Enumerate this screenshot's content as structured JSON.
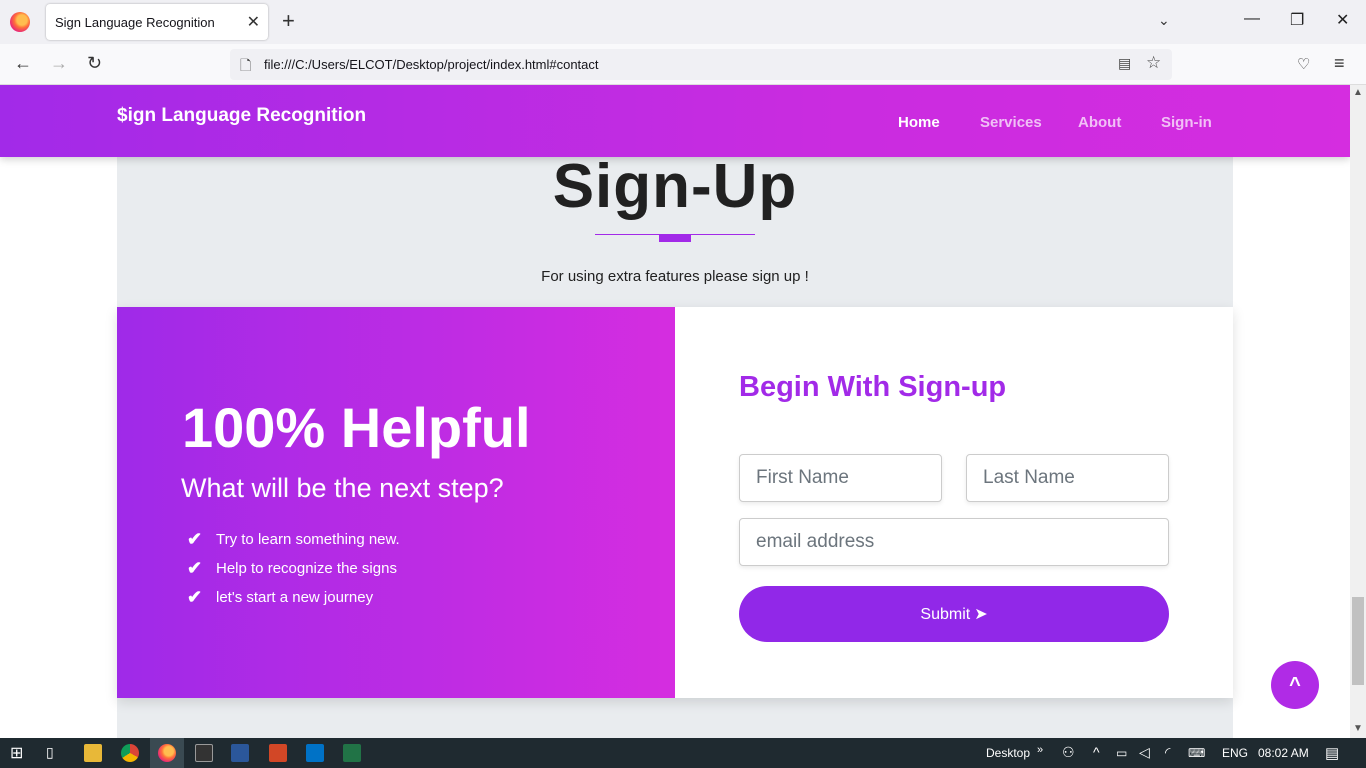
{
  "browser": {
    "tab_title": "Sign Language Recognition",
    "tab_close": "✕",
    "new_tab": "+",
    "url": "file:///C:/Users/ELCOT/Desktop/project/index.html#contact"
  },
  "site": {
    "brand": "$ign Language Recognition",
    "menu": [
      "Home",
      "Services",
      "About",
      "Sign-in"
    ]
  },
  "signup": {
    "title": "Sign-Up",
    "subtitle": "For using extra features please sign up !"
  },
  "promo": {
    "headline": "100% Helpful",
    "subheadline": "What will be the next step?",
    "features": [
      "Try to learn something new.",
      "Help to recognize the signs",
      "let's start a new journey"
    ]
  },
  "form": {
    "title": "Begin With Sign-up",
    "first_name_placeholder": "First Name",
    "last_name_placeholder": "Last Name",
    "email_placeholder": "email address",
    "submit_label": "Submit"
  },
  "taskbar": {
    "desktop_label": "Desktop",
    "language": "ENG",
    "time": "08:02 AM"
  },
  "colors": {
    "accent": "#a22ae8",
    "accent_end": "#d52de0",
    "submit": "#9128e8"
  }
}
